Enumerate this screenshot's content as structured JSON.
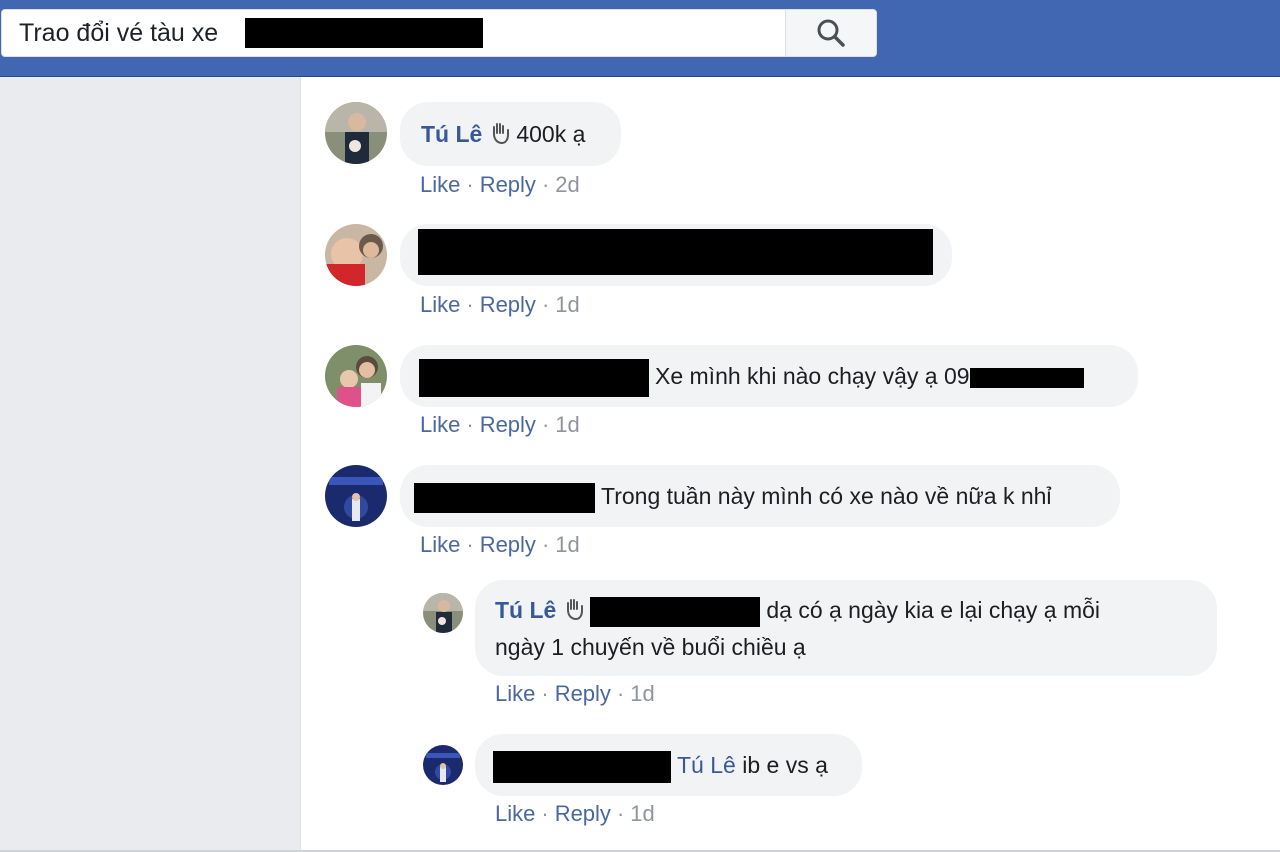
{
  "search": {
    "query": "Trao đổi vé tàu xe"
  },
  "comments": [
    {
      "author": "Tú Lê",
      "text": "400k ạ",
      "like": "Like",
      "reply": "Reply",
      "time": "2d"
    },
    {
      "like": "Like",
      "reply": "Reply",
      "time": "1d"
    },
    {
      "text": "Xe mình khi nào chạy vậy ạ 09",
      "like": "Like",
      "reply": "Reply",
      "time": "1d"
    },
    {
      "text": "Trong tuần này mình có xe nào về nữa k nhỉ",
      "like": "Like",
      "reply": "Reply",
      "time": "1d"
    }
  ],
  "replies": [
    {
      "author": "Tú Lê",
      "text_line1": "dạ có ạ ngày kia e lại chạy ạ mỗi",
      "text_line2": "ngày 1 chuyến về buổi chiều ạ",
      "like": "Like",
      "reply": "Reply",
      "time": "1d"
    },
    {
      "tag": "Tú Lê",
      "text": "ib e vs ạ",
      "like": "Like",
      "reply": "Reply",
      "time": "1d"
    }
  ]
}
